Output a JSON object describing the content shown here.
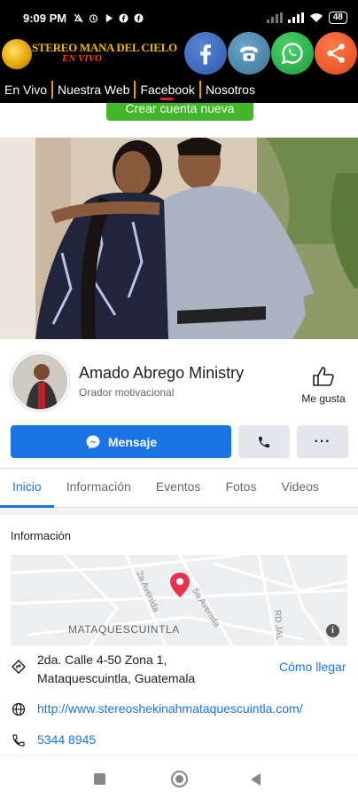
{
  "status_bar": {
    "time": "9:09 PM",
    "battery": "48"
  },
  "app_header": {
    "logo_title": "STEREO MANA DEL CIELO",
    "logo_subtitle": "EN VIVO",
    "social_icons": [
      "facebook-icon",
      "phone-icon",
      "whatsapp-icon",
      "share-icon"
    ],
    "menu": [
      "En Vivo",
      "Nuestra Web",
      "Facebook",
      "Nosotros"
    ],
    "active_menu": "Facebook"
  },
  "create_account_button": "Crear cuenta nueva",
  "profile": {
    "name": "Amado Abrego Ministry",
    "category": "Orador motivacional",
    "like_label": "Me gusta"
  },
  "actions": {
    "message_label": "Mensaje",
    "more_label": "···"
  },
  "tabs": [
    "Inicio",
    "Información",
    "Eventos",
    "Fotos",
    "Videos"
  ],
  "active_tab": "Inicio",
  "info": {
    "title": "Información",
    "map_city": "MATAQUESCUINTLA",
    "map_streets": [
      "2a Avenida",
      "5a Avenida",
      "RD JAL"
    ],
    "map_info_badge": "i",
    "address_line1": "2da. Calle 4-50 Zona 1,",
    "address_line2": "Mataquescuintla, Guatemala",
    "directions": "Cómo llegar",
    "website": "http://www.stereoshekinahmataquescuintla.com/",
    "phone": "5344 8945"
  },
  "colors": {
    "facebook_blue": "#1b74e4",
    "green": "#42b72a",
    "gold": "#e2a100"
  }
}
